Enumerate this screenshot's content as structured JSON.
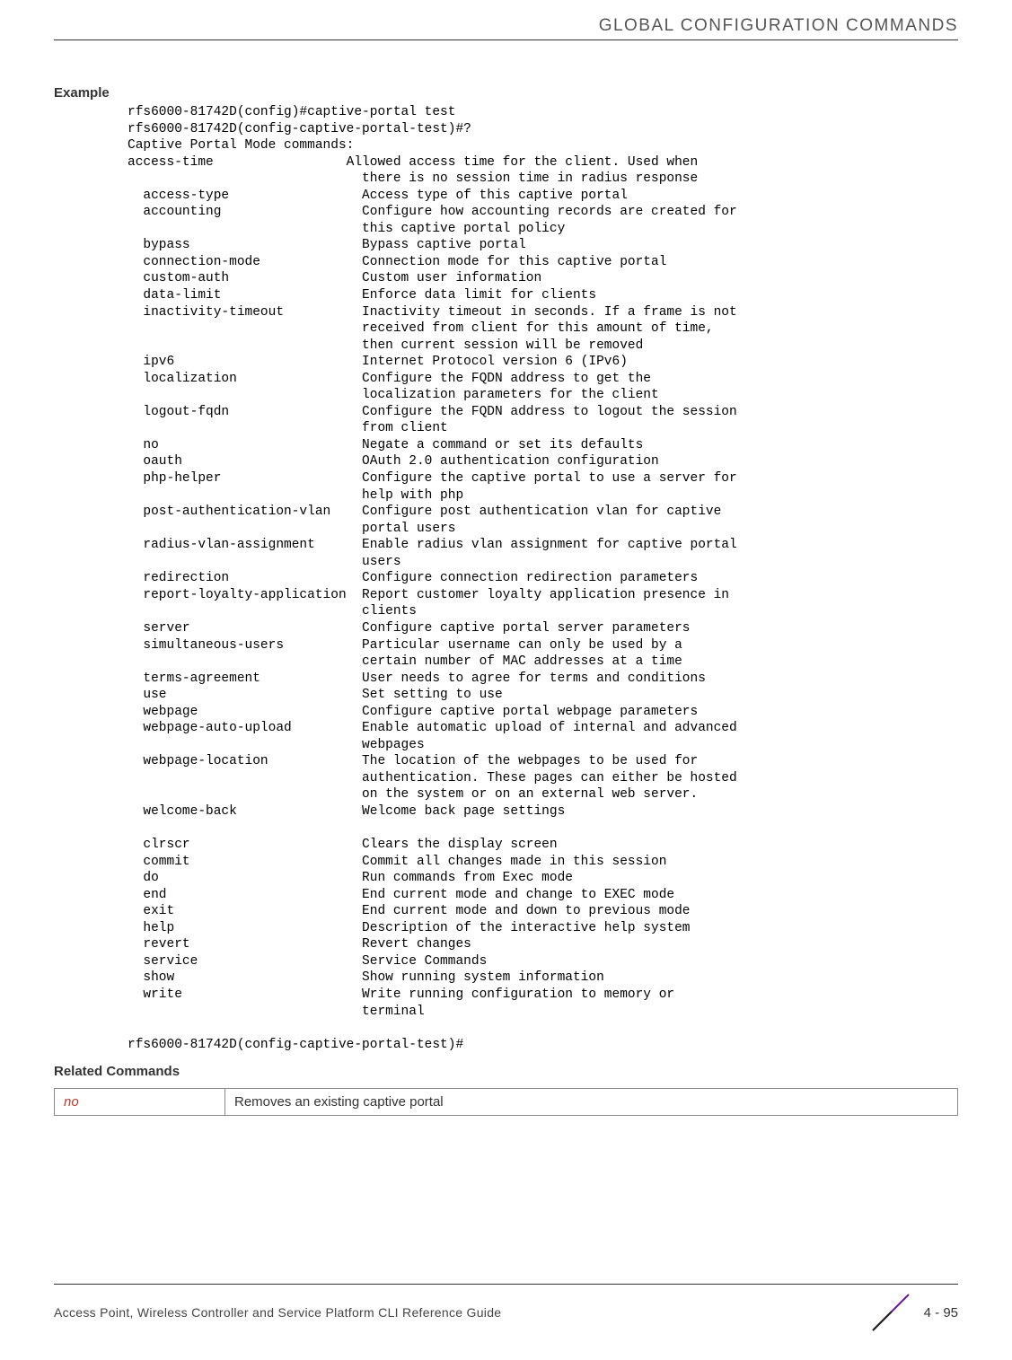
{
  "header": {
    "title": "GLOBAL CONFIGURATION COMMANDS"
  },
  "example": {
    "heading": "Example",
    "code": "rfs6000-81742D(config)#captive-portal test\nrfs6000-81742D(config-captive-portal-test)#?\nCaptive Portal Mode commands:\naccess-time                 Allowed access time for the client. Used when\n                              there is no session time in radius response\n  access-type                 Access type of this captive portal\n  accounting                  Configure how accounting records are created for\n                              this captive portal policy\n  bypass                      Bypass captive portal\n  connection-mode             Connection mode for this captive portal\n  custom-auth                 Custom user information\n  data-limit                  Enforce data limit for clients\n  inactivity-timeout          Inactivity timeout in seconds. If a frame is not\n                              received from client for this amount of time,\n                              then current session will be removed\n  ipv6                        Internet Protocol version 6 (IPv6)\n  localization                Configure the FQDN address to get the\n                              localization parameters for the client\n  logout-fqdn                 Configure the FQDN address to logout the session\n                              from client\n  no                          Negate a command or set its defaults\n  oauth                       OAuth 2.0 authentication configuration\n  php-helper                  Configure the captive portal to use a server for\n                              help with php\n  post-authentication-vlan    Configure post authentication vlan for captive\n                              portal users\n  radius-vlan-assignment      Enable radius vlan assignment for captive portal\n                              users\n  redirection                 Configure connection redirection parameters\n  report-loyalty-application  Report customer loyalty application presence in\n                              clients\n  server                      Configure captive portal server parameters\n  simultaneous-users          Particular username can only be used by a\n                              certain number of MAC addresses at a time\n  terms-agreement             User needs to agree for terms and conditions\n  use                         Set setting to use\n  webpage                     Configure captive portal webpage parameters\n  webpage-auto-upload         Enable automatic upload of internal and advanced\n                              webpages\n  webpage-location            The location of the webpages to be used for\n                              authentication. These pages can either be hosted\n                              on the system or on an external web server.\n  welcome-back                Welcome back page settings\n\n  clrscr                      Clears the display screen\n  commit                      Commit all changes made in this session\n  do                          Run commands from Exec mode\n  end                         End current mode and change to EXEC mode\n  exit                        End current mode and down to previous mode\n  help                        Description of the interactive help system\n  revert                      Revert changes\n  service                     Service Commands\n  show                        Show running system information\n  write                       Write running configuration to memory or\n                              terminal\n\nrfs6000-81742D(config-captive-portal-test)#"
  },
  "related": {
    "heading": "Related Commands",
    "rows": [
      {
        "cmd": "no",
        "desc": "Removes an existing captive portal"
      }
    ]
  },
  "footer": {
    "left": "Access Point, Wireless Controller and Service Platform CLI Reference Guide",
    "page": "4 - 95"
  }
}
